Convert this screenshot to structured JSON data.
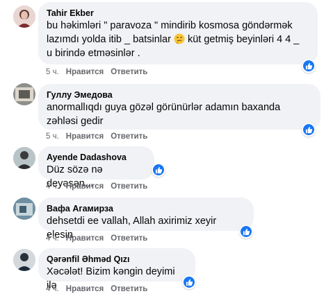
{
  "comments": [
    {
      "author": "Tahir Ekber",
      "lines": [
        "bu həkimləri \" paravoza \" mindirib kosmosa göndərmək",
        "lazımdı yolda itib _ batsinlar",
        " küt getmiş beyinləri 4 4 _",
        "u birində etməsinlər ."
      ],
      "emoji": "thinking-face-emoji",
      "time": "5 ч.",
      "like_label": "Нравится",
      "reply_label": "Ответить"
    },
    {
      "author": "Гуллу Эмедова",
      "lines": [
        "anormallıqdı guya gözəl görünürlər adamın baxanda",
        "zəhləsi gedir"
      ],
      "time": "5 ч.",
      "like_label": "Нравится",
      "reply_label": "Ответить"
    },
    {
      "author": "Ayende Dadashova",
      "lines": [
        "Düz sözə nə deyəsən..."
      ],
      "time": "4 ч.",
      "like_label": "Нравится",
      "reply_label": "Ответить"
    },
    {
      "author": "Вафа Агамирза",
      "lines": [
        "dehsetdi ee vallah, Allah axirimiz xeyir elesin"
      ],
      "time": "4 ч.",
      "like_label": "Нравится",
      "reply_label": "Ответить"
    },
    {
      "author": "Qərənfil Əhməd Qızı",
      "lines": [
        "Xəcələt! Bizim kəngin deyimi ilə"
      ],
      "time": "4 ч.",
      "like_label": "Нравится",
      "reply_label": "Ответить"
    }
  ],
  "colors": {
    "bubble": "#f0f2f5",
    "like_blue": "#1877f2",
    "meta_gray": "#65676b"
  },
  "icons": {
    "like": "thumbs-up-icon"
  }
}
